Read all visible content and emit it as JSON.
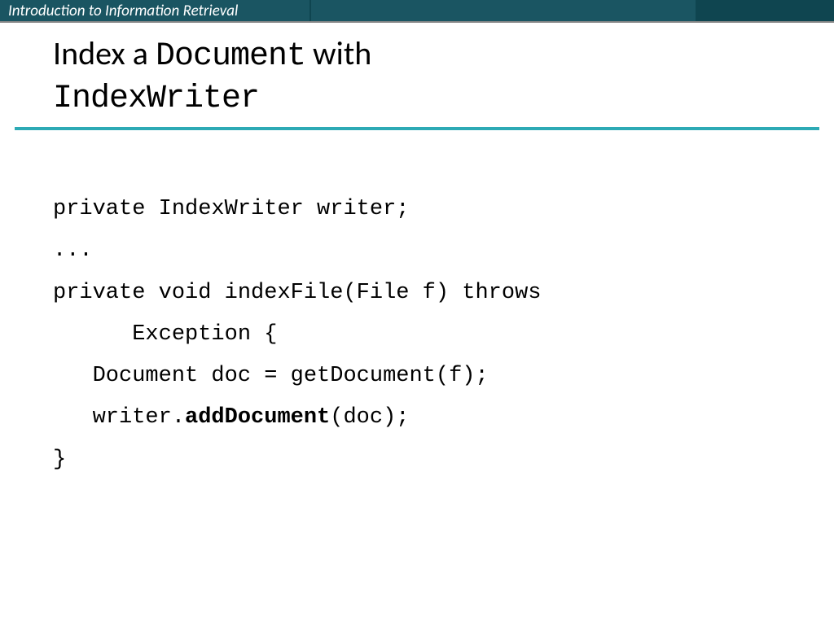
{
  "header": {
    "course_title": "Introduction to Information Retrieval"
  },
  "title": {
    "part1": "Index a ",
    "mono1": "Document",
    "part2": " with ",
    "mono2": "IndexWriter"
  },
  "code": {
    "line1": "private IndexWriter writer;",
    "line2": "...",
    "line3": "private void indexFile(File f) throws",
    "line4": "      Exception {",
    "line5": "   Document doc = getDocument(f);",
    "line6_prefix": "   writer.",
    "line6_bold": "addDocument",
    "line6_suffix": "(doc);",
    "line7": "}"
  }
}
